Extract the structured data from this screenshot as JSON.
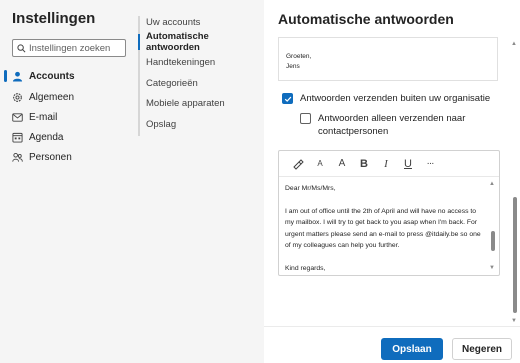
{
  "app": {
    "title": "Instellingen"
  },
  "search": {
    "placeholder": "Instellingen zoeken"
  },
  "nav": {
    "items": [
      {
        "label": "Accounts",
        "icon": "person-icon",
        "active": true
      },
      {
        "label": "Algemeen",
        "icon": "gear-icon"
      },
      {
        "label": "E-mail",
        "icon": "mail-icon"
      },
      {
        "label": "Agenda",
        "icon": "calendar-icon"
      },
      {
        "label": "Personen",
        "icon": "people-icon"
      }
    ]
  },
  "subnav": {
    "items": [
      {
        "label": "Uw accounts"
      },
      {
        "label": "Automatische antwoorden",
        "active": true
      },
      {
        "label": "Handtekeningen"
      },
      {
        "label": "Categorieën"
      },
      {
        "label": "Mobiele apparaten"
      },
      {
        "label": "Opslag"
      }
    ]
  },
  "main": {
    "title": "Automatische antwoorden",
    "preview": {
      "line1": "Groeten,",
      "line2": "Jens"
    },
    "outside_checkbox": {
      "label": "Antwoorden verzenden buiten uw organisatie",
      "checked": true
    },
    "contacts_checkbox": {
      "label": "Antwoorden alleen verzenden naar contactpersonen",
      "checked": false
    },
    "toolbar": {
      "items": [
        {
          "name": "format-painter-icon",
          "glyph": ""
        },
        {
          "name": "font-size-decrease-icon",
          "glyph": "A"
        },
        {
          "name": "font-size-increase-icon",
          "glyph": "A"
        },
        {
          "name": "bold-icon",
          "glyph": "B"
        },
        {
          "name": "italic-icon",
          "glyph": "I"
        },
        {
          "name": "underline-icon",
          "glyph": "U"
        },
        {
          "name": "more-icon",
          "glyph": "···"
        }
      ]
    },
    "editor": {
      "greeting": "Dear Mr/Ms/Mrs,",
      "body": "I am out of office until the 2th of April and will have no access to my mailbox. I will try to get back to you asap when I'm back. For urgent matters please send an e-mail to press @itdaily.be so one of my colleagues can help you further.",
      "closing": "Kind regards,"
    }
  },
  "footer": {
    "save_label": "Opslaan",
    "cancel_label": "Negeren"
  },
  "colors": {
    "accent": "#0f6cbd",
    "panel": "#f5f5f5"
  }
}
